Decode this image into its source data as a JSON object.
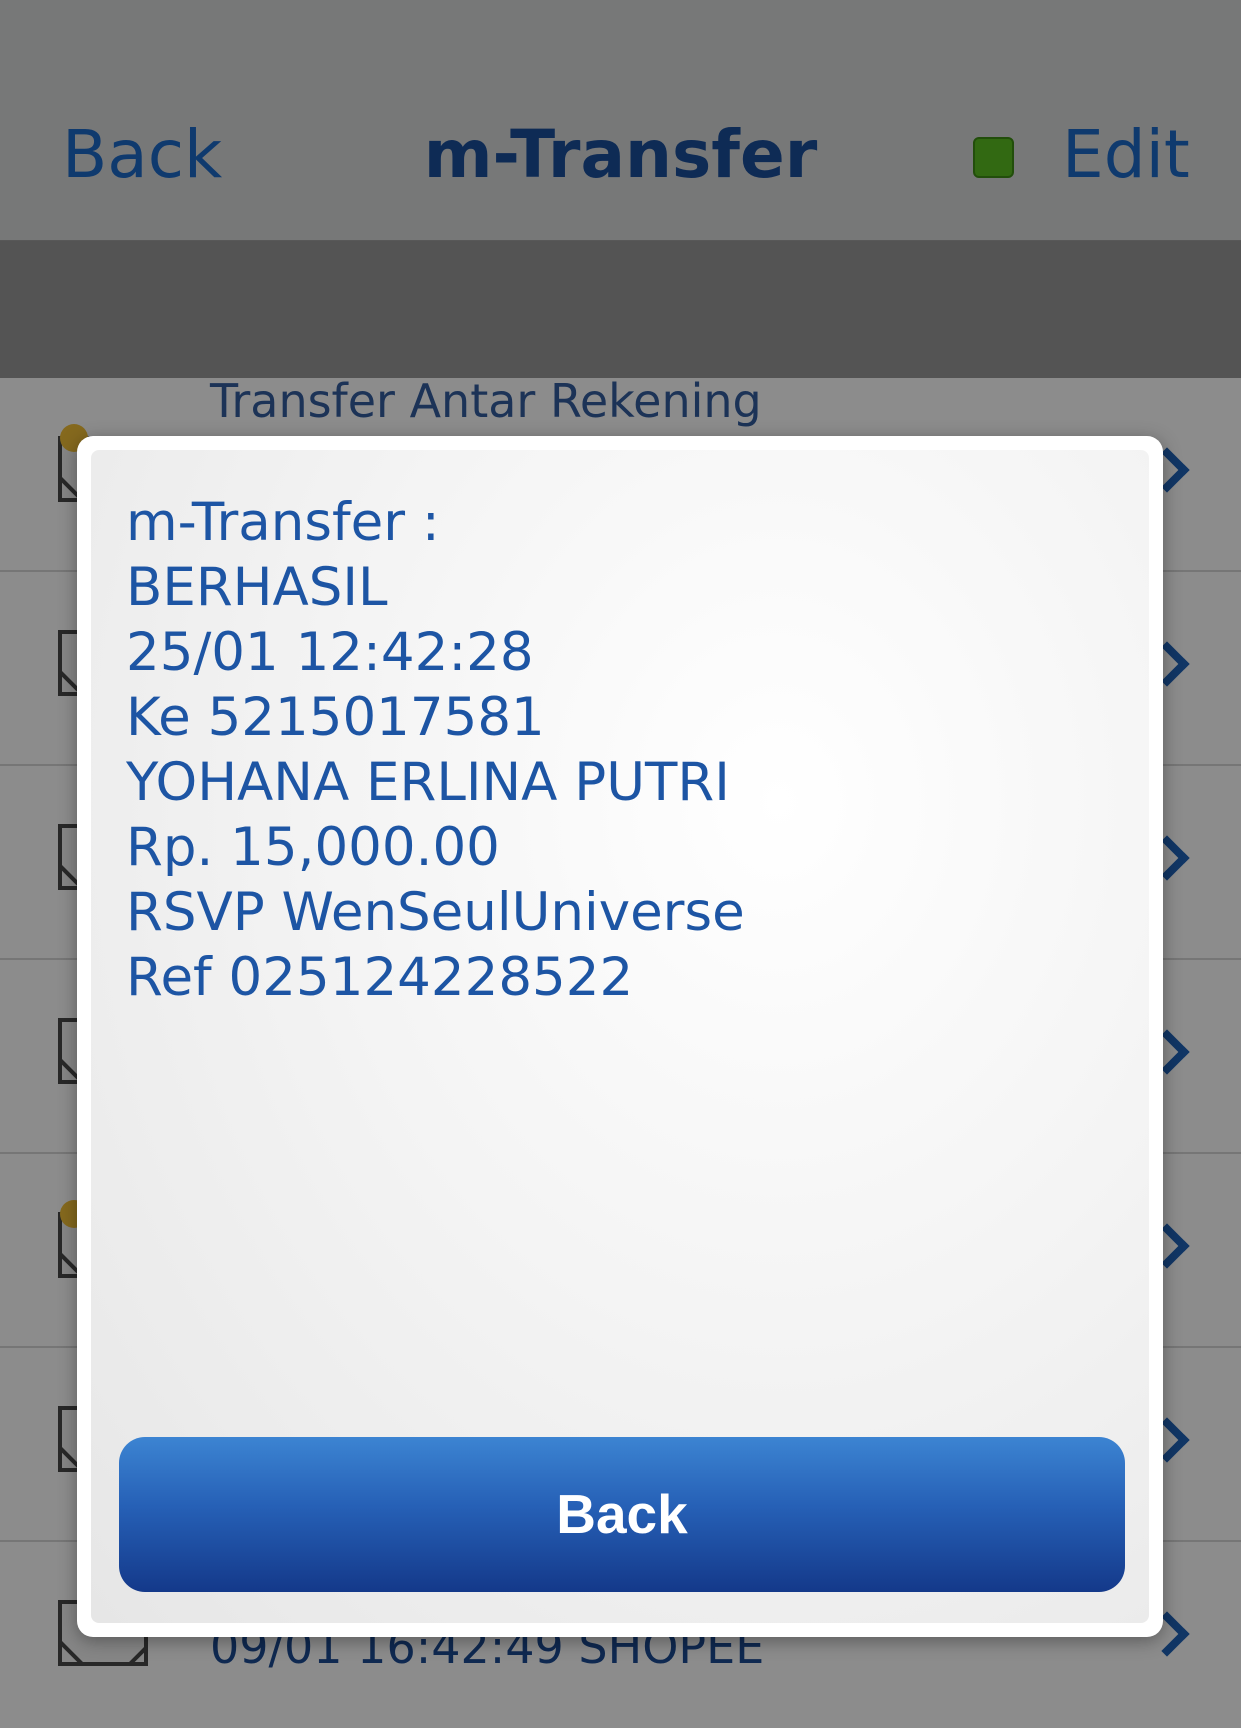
{
  "navbar": {
    "back_label": "Back",
    "title": "m-Transfer",
    "edit_label": "Edit",
    "status_color": "#5bc021"
  },
  "list": {
    "rows": [
      {
        "text": "Transfer Antar Rekening",
        "icon": "envelope-icon",
        "badge": true
      },
      {
        "text": "",
        "icon": "envelope-icon",
        "badge": false
      },
      {
        "text": "",
        "icon": "envelope-icon",
        "badge": false
      },
      {
        "text": "",
        "icon": "envelope-icon",
        "badge": false
      },
      {
        "text": "",
        "icon": "envelope-icon",
        "badge": true
      },
      {
        "text": "",
        "icon": "envelope-icon",
        "badge": false
      },
      {
        "text": "09/01 16:42:49 SHOPEE",
        "icon": "envelope-icon",
        "badge": false
      }
    ]
  },
  "dialog": {
    "lines": [
      "m-Transfer :",
      "BERHASIL",
      "25/01 12:42:28",
      "Ke 5215017581",
      "YOHANA ERLINA PUTRI",
      "Rp. 15,000.00",
      "RSVP WenSeulUniverse",
      "Ref 025124228522"
    ],
    "back_button_label": "Back"
  },
  "colors": {
    "accent": "#1d6ac9",
    "title": "#1b4f9c",
    "button_gradient_top": "#3c84d2",
    "button_gradient_bottom": "#14398a"
  }
}
